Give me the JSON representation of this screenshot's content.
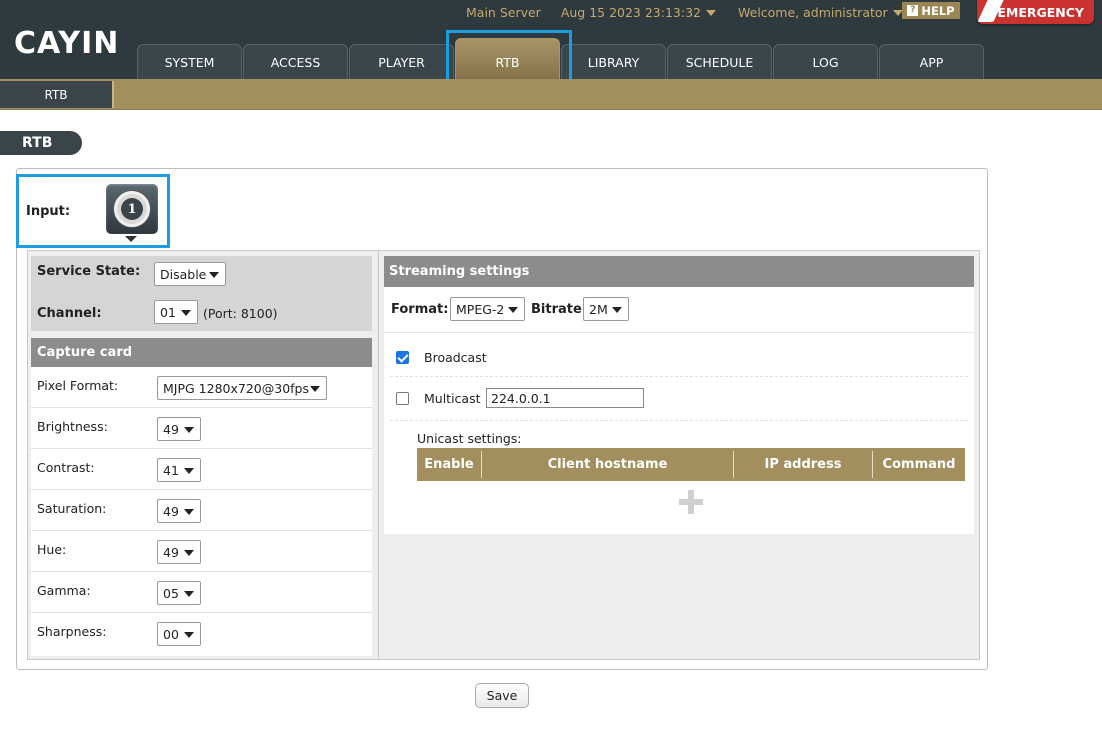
{
  "header": {
    "logo": "CAYIN",
    "server": "Main Server",
    "datetime": "Aug 15 2023 23:13:32",
    "welcome": "Welcome, administrator",
    "help": "HELP",
    "emergency": "EMERGENCY"
  },
  "tabs": [
    {
      "label": "SYSTEM"
    },
    {
      "label": "ACCESS"
    },
    {
      "label": "PLAYER"
    },
    {
      "label": "RTB",
      "active": true
    },
    {
      "label": "LIBRARY"
    },
    {
      "label": "SCHEDULE"
    },
    {
      "label": "LOG"
    },
    {
      "label": "APP"
    }
  ],
  "subtab": "RTB",
  "section_title": "RTB",
  "input": {
    "label": "Input:",
    "number": "1"
  },
  "service": {
    "state_label": "Service State:",
    "state_value": "Disable",
    "channel_label": "Channel:",
    "channel_value": "01",
    "port_text": "(Port: 8100)"
  },
  "capture": {
    "title": "Capture card",
    "rows": [
      {
        "name": "Pixel Format:",
        "value": "MJPG 1280x720@30fps"
      },
      {
        "name": "Brightness:",
        "value": "49"
      },
      {
        "name": "Contrast:",
        "value": "41"
      },
      {
        "name": "Saturation:",
        "value": "49"
      },
      {
        "name": "Hue:",
        "value": "49"
      },
      {
        "name": "Gamma:",
        "value": "05"
      },
      {
        "name": "Sharpness:",
        "value": "00"
      }
    ]
  },
  "streaming": {
    "title": "Streaming settings",
    "format_label": "Format:",
    "format_value": "MPEG-2",
    "bitrate_label": "Bitrate",
    "bitrate_value": "2M",
    "broadcast_label": "Broadcast",
    "broadcast_checked": true,
    "multicast_label": "Multicast",
    "multicast_checked": false,
    "multicast_ip": "224.0.0.1",
    "unicast_label": "Unicast settings:",
    "unicast_columns": [
      "Enable",
      "Client hostname",
      "IP address",
      "Command"
    ]
  },
  "save_label": "Save",
  "colors": {
    "accent": "#a38e5e",
    "dark": "#2f3a3f",
    "highlight": "#1a9ee0"
  }
}
